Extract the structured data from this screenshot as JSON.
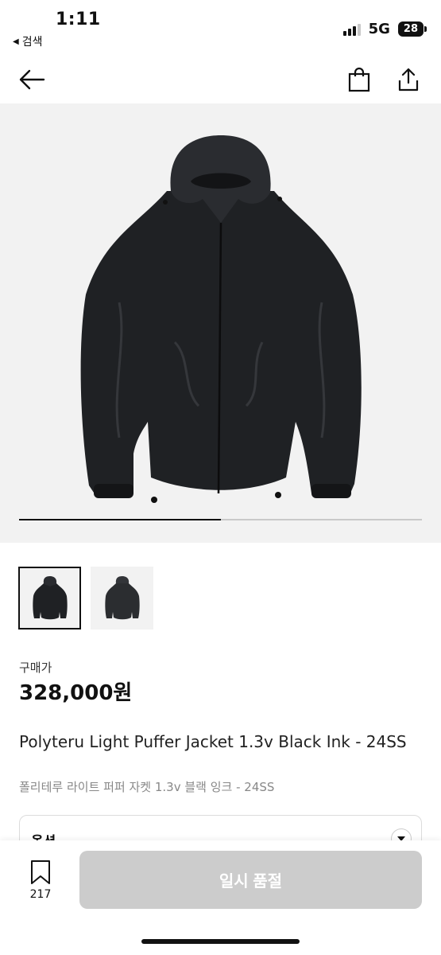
{
  "status_bar": {
    "time": "1:11",
    "back_app": "검색",
    "network": "5G",
    "battery": "28"
  },
  "nav": {
    "back_icon": "arrow-left-icon",
    "bag_icon": "shopping-bag-icon",
    "share_icon": "share-icon"
  },
  "gallery": {
    "current": 1,
    "total": 2,
    "progress": 0.5
  },
  "price": {
    "label": "구매가",
    "value": "328,000원"
  },
  "product": {
    "title_en": "Polyteru Light Puffer Jacket 1.3v Black Ink - 24SS",
    "title_ko": "폴리테루 라이트 퍼퍼 자켓 1.3v 블랙 잉크 - 24SS"
  },
  "option": {
    "label": "옵션"
  },
  "bottom": {
    "wish_count": "217",
    "buy_label": "일시 품절",
    "buy_disabled_color": "#cccccc"
  }
}
